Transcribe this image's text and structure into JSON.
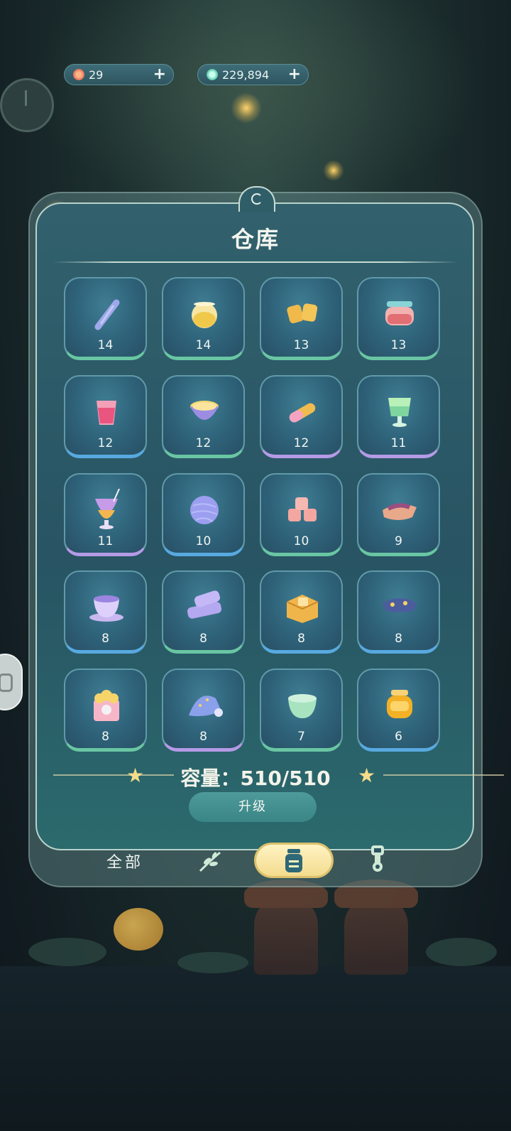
{
  "currency": {
    "flower": {
      "value": "29",
      "plus": "+"
    },
    "gem": {
      "value": "229,894",
      "plus": "+"
    }
  },
  "warehouse": {
    "title": "仓库",
    "capacity_label": "容量：510/510",
    "upgrade_label": "升级",
    "items": [
      {
        "name": "rope",
        "count": "14",
        "rarity": "green",
        "icon": "rope-icon"
      },
      {
        "name": "honey-glass",
        "count": "14",
        "rarity": "green",
        "icon": "glass-bowl-icon"
      },
      {
        "name": "biscuits",
        "count": "13",
        "rarity": "green",
        "icon": "biscuit-icon"
      },
      {
        "name": "jam-jar",
        "count": "13",
        "rarity": "green",
        "icon": "jam-jar-icon"
      },
      {
        "name": "pink-drink",
        "count": "12",
        "rarity": "blue",
        "icon": "pink-cup-icon"
      },
      {
        "name": "pudding-cup",
        "count": "12",
        "rarity": "green",
        "icon": "pudding-icon"
      },
      {
        "name": "capsule",
        "count": "12",
        "rarity": "purple",
        "icon": "capsule-icon"
      },
      {
        "name": "green-smoothie",
        "count": "11",
        "rarity": "purple",
        "icon": "goblet-icon"
      },
      {
        "name": "fancy-cocktail",
        "count": "11",
        "rarity": "purple",
        "icon": "cocktail-icon"
      },
      {
        "name": "yarn-ball",
        "count": "10",
        "rarity": "blue",
        "icon": "yarn-icon"
      },
      {
        "name": "fabric-rolls",
        "count": "10",
        "rarity": "green",
        "icon": "rolls-icon"
      },
      {
        "name": "cloth-bundle",
        "count": "9",
        "rarity": "green",
        "icon": "cloth-icon"
      },
      {
        "name": "moon-teacup",
        "count": "8",
        "rarity": "blue",
        "icon": "teacup-icon"
      },
      {
        "name": "towels",
        "count": "8",
        "rarity": "green",
        "icon": "towel-icon"
      },
      {
        "name": "snack-box",
        "count": "8",
        "rarity": "blue",
        "icon": "box-icon"
      },
      {
        "name": "sleep-mask",
        "count": "8",
        "rarity": "blue",
        "icon": "mask-icon"
      },
      {
        "name": "popcorn",
        "count": "8",
        "rarity": "green",
        "icon": "popcorn-icon"
      },
      {
        "name": "nightcap",
        "count": "8",
        "rarity": "purple",
        "icon": "nightcap-icon"
      },
      {
        "name": "green-bowl",
        "count": "7",
        "rarity": "green",
        "icon": "bowl-icon"
      },
      {
        "name": "honey-jar",
        "count": "6",
        "rarity": "blue",
        "icon": "honey-jar-icon"
      }
    ]
  },
  "tabs": {
    "all_label": "全部",
    "plant": "plant-icon",
    "storage": "jar-icon",
    "tool": "tool-icon"
  }
}
